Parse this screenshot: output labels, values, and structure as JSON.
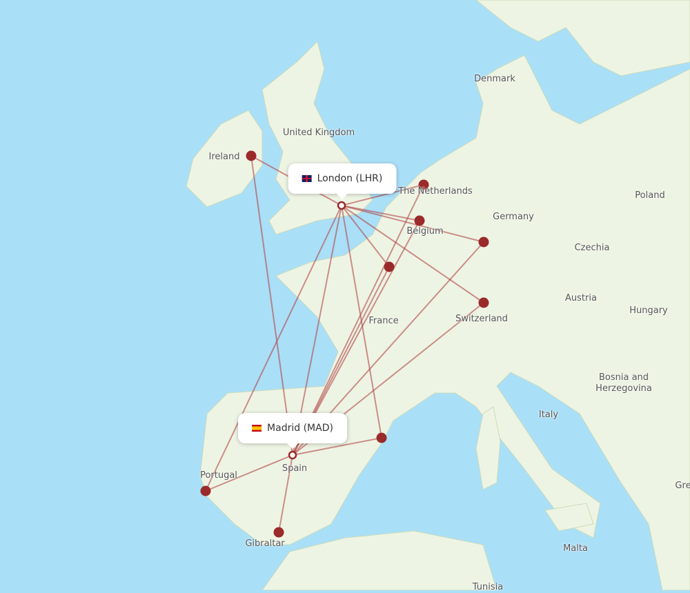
{
  "colors": {
    "water": "#aadff8",
    "land": "#eef4e4",
    "route": "#b04848",
    "marker": "#9b2a2a"
  },
  "airports": {
    "origin_1": {
      "label": "London (LHR)",
      "flag": "uk-flag-icon"
    },
    "origin_2": {
      "label": "Madrid (MAD)",
      "flag": "spain-flag-icon"
    }
  },
  "place_labels": [
    "Denmark",
    "United Kingdom",
    "Ireland",
    "The Netherlands",
    "Germany",
    "Poland",
    "Belgium",
    "Czechia",
    "Austria",
    "Hungary",
    "France",
    "Switzerland",
    "Bosnia and Herzegovina",
    "Italy",
    "Portugal",
    "Spain",
    "Gibraltar",
    "Malta",
    "Tunisia",
    "Gre"
  ]
}
